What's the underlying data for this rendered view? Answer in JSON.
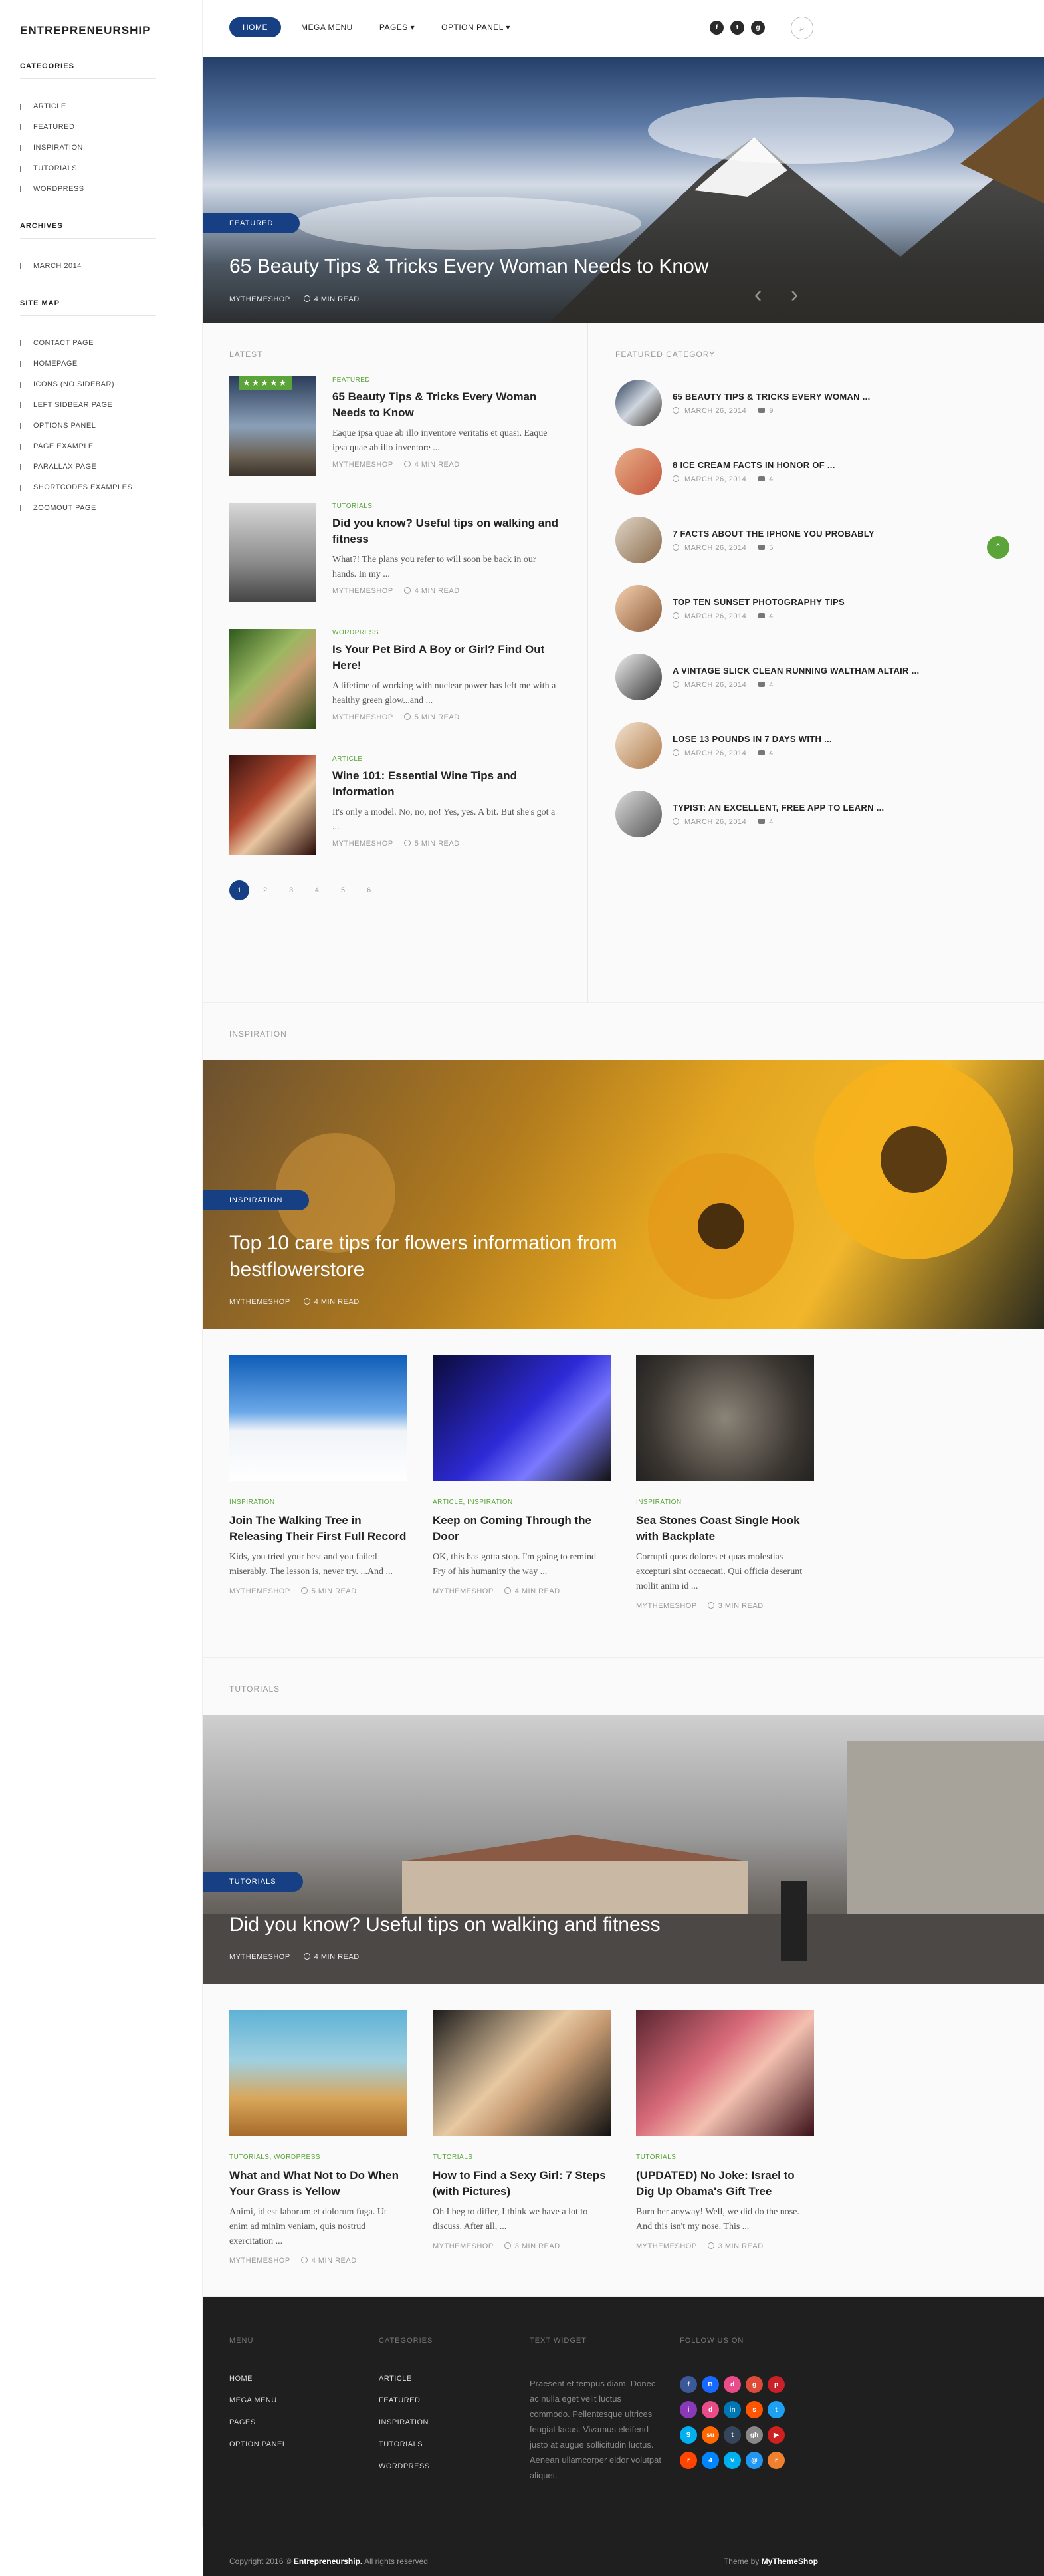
{
  "site": {
    "logo": "ENTREPRENEURSHIP"
  },
  "sidebar": {
    "categories_title": "CATEGORIES",
    "categories": [
      "ARTICLE",
      "FEATURED",
      "INSPIRATION",
      "TUTORIALS",
      "WORDPRESS"
    ],
    "archives_title": "ARCHIVES",
    "archives": [
      "MARCH 2014"
    ],
    "sitemap_title": "SITE MAP",
    "sitemap": [
      "CONTACT PAGE",
      "HOMEPAGE",
      "ICONS (NO SIDEBAR)",
      "LEFT SIDBEAR PAGE",
      "OPTIONS PANEL",
      "PAGE EXAMPLE",
      "PARALLAX PAGE",
      "SHORTCODES EXAMPLES",
      "ZOOMOUT PAGE"
    ]
  },
  "nav": {
    "items": [
      "HOME",
      "MEGA MENU",
      "PAGES ▾",
      "OPTION PANEL ▾"
    ],
    "search_icon": "search-icon"
  },
  "hero": {
    "badge": "FEATURED",
    "title": "65 Beauty Tips & Tricks Every Woman Needs to Know",
    "author": "MYTHEMESHOP",
    "read": "4 MIN READ"
  },
  "latest": {
    "title": "LATEST",
    "posts": [
      {
        "cat": "FEATURED",
        "title": "65 Beauty Tips & Tricks Every Woman Needs to Know",
        "excerpt": "Eaque ipsa quae ab illo inventore veritatis et quasi. Eaque ipsa quae ab illo inventore ...",
        "author": "MYTHEMESHOP",
        "read": "4 MIN READ",
        "stars": "★★★★★"
      },
      {
        "cat": "TUTORIALS",
        "title": "Did you know? Useful tips on walking and fitness",
        "excerpt": "What?! The plans you refer to will soon be back in our hands. In my ...",
        "author": "MYTHEMESHOP",
        "read": "4 MIN READ"
      },
      {
        "cat": "WORDPRESS",
        "title": "Is Your Pet Bird A Boy or Girl? Find Out Here!",
        "excerpt": "A lifetime of working with nuclear power has left me with a healthy green glow...and ...",
        "author": "MYTHEMESHOP",
        "read": "5 MIN READ"
      },
      {
        "cat": "ARTICLE",
        "title": "Wine 101: Essential Wine Tips and Information",
        "excerpt": "It's only a model. No, no, no! Yes, yes. A bit. But she's got a ...",
        "author": "MYTHEMESHOP",
        "read": "5 MIN READ"
      }
    ],
    "pages": [
      "1",
      "2",
      "3",
      "4",
      "5",
      "6"
    ]
  },
  "featured_category": {
    "title": "FEATURED CATEGORY",
    "items": [
      {
        "title": "65 BEAUTY TIPS & TRICKS EVERY WOMAN ...",
        "date": "MARCH 26, 2014",
        "comments": "9"
      },
      {
        "title": "8 ICE CREAM FACTS IN HONOR OF ...",
        "date": "MARCH 26, 2014",
        "comments": "4"
      },
      {
        "title": "7 FACTS ABOUT THE IPHONE YOU PROBABLY",
        "date": "MARCH 26, 2014",
        "comments": "5"
      },
      {
        "title": "TOP TEN SUNSET PHOTOGRAPHY TIPS",
        "date": "MARCH 26, 2014",
        "comments": "4"
      },
      {
        "title": "A VINTAGE SLICK CLEAN RUNNING WALTHAM ALTAIR ...",
        "date": "MARCH 26, 2014",
        "comments": "4"
      },
      {
        "title": "LOSE 13 POUNDS IN 7 DAYS WITH ...",
        "date": "MARCH 26, 2014",
        "comments": "4"
      },
      {
        "title": "TYPIST: AN EXCELLENT, FREE APP TO LEARN ...",
        "date": "MARCH 26, 2014",
        "comments": "4"
      }
    ]
  },
  "inspiration": {
    "title": "INSPIRATION",
    "hero": {
      "badge": "INSPIRATION",
      "title": "Top 10 care tips for flowers information from bestflowerstore",
      "author": "MYTHEMESHOP",
      "read": "4 MIN READ"
    },
    "cards": [
      {
        "cat": "INSPIRATION",
        "title": "Join The Walking Tree in Releasing Their First Full Record",
        "excerpt": "Kids, you tried your best and you failed miserably. The lesson is, never try. ...And ...",
        "author": "MYTHEMESHOP",
        "read": "5 MIN READ"
      },
      {
        "cat": "ARTICLE, INSPIRATION",
        "title": "Keep on Coming Through the Door",
        "excerpt": "OK, this has gotta stop. I'm going to remind Fry of his humanity the way ...",
        "author": "MYTHEMESHOP",
        "read": "4 MIN READ"
      },
      {
        "cat": "INSPIRATION",
        "title": "Sea Stones Coast Single Hook with Backplate",
        "excerpt": "Corrupti quos dolores et quas molestias excepturi sint occaecati. Qui officia deserunt mollit anim id ...",
        "author": "MYTHEMESHOP",
        "read": "3 MIN READ"
      }
    ]
  },
  "tutorials": {
    "title": "TUTORIALS",
    "hero": {
      "badge": "TUTORIALS",
      "title": "Did you know? Useful tips on walking and fitness",
      "author": "MYTHEMESHOP",
      "read": "4 MIN READ"
    },
    "cards": [
      {
        "cat": "TUTORIALS, WORDPRESS",
        "title": "What and What Not to Do When Your Grass is Yellow",
        "excerpt": "Animi, id est laborum et dolorum fuga. Ut enim ad minim veniam, quis nostrud exercitation ...",
        "author": "MYTHEMESHOP",
        "read": "4 MIN READ"
      },
      {
        "cat": "TUTORIALS",
        "title": "How to Find a Sexy Girl: 7 Steps (with Pictures)",
        "excerpt": "Oh I beg to differ, I think we have a lot to discuss. After all, ...",
        "author": "MYTHEMESHOP",
        "read": "3 MIN READ"
      },
      {
        "cat": "TUTORIALS",
        "title": "(UPDATED) No Joke: Israel to Dig Up Obama's Gift Tree",
        "excerpt": "Burn her anyway! Well, we did do the nose. And this isn't my nose. This ...",
        "author": "MYTHEMESHOP",
        "read": "3 MIN READ"
      }
    ]
  },
  "footer": {
    "menu_title": "MENU",
    "menu": [
      "HOME",
      "MEGA MENU",
      "PAGES",
      "OPTION PANEL"
    ],
    "cat_title": "CATEGORIES",
    "cats": [
      "ARTICLE",
      "FEATURED",
      "INSPIRATION",
      "TUTORIALS",
      "WORDPRESS"
    ],
    "text_title": "TEXT WIDGET",
    "text": "Praesent et tempus diam. Donec ac nulla eget velit luctus commodo. Pellentesque ultrices feugiat lacus. Vivamus eleifend justo at augue sollicitudin luctus. Aenean ullamcorper eldor volutpat aliquet.",
    "follow_title": "FOLLOW US ON",
    "copyright_pre": "Copyright 2016 ©",
    "copyright_site": "Entrepreneurship.",
    "copyright_post": "All rights reserved",
    "theme_pre": "Theme by",
    "theme_by": "MyThemeShop"
  }
}
